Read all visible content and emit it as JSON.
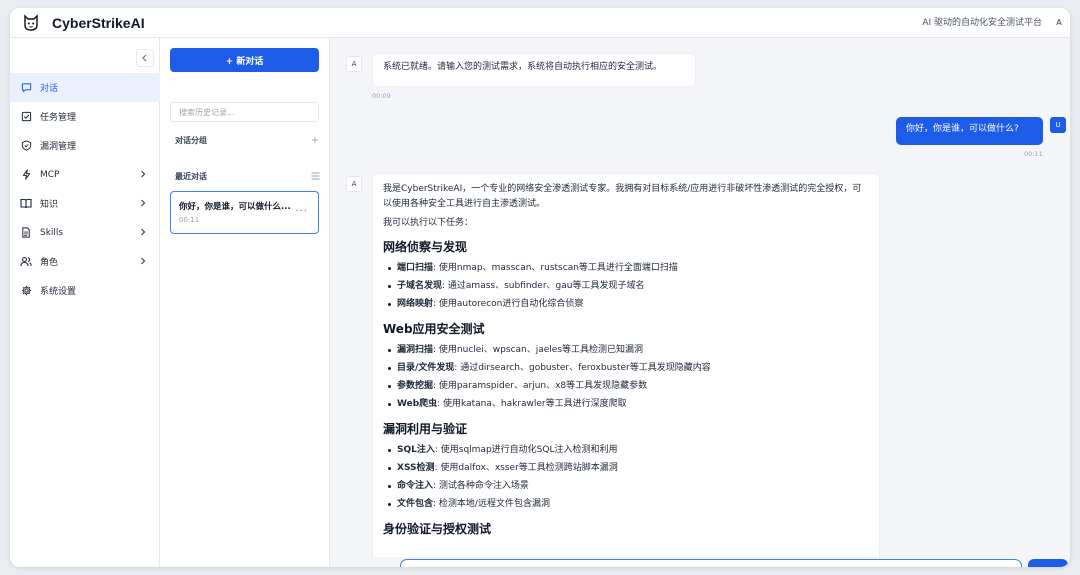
{
  "app": {
    "title": "CyberStrikeAI",
    "tagline": "AI 驱动的自动化安全测试平台",
    "user_initial": "A"
  },
  "sidebar": {
    "items": [
      {
        "label": "对话",
        "icon": "chat-icon",
        "active": true
      },
      {
        "label": "任务管理",
        "icon": "task-icon"
      },
      {
        "label": "漏洞管理",
        "icon": "shield-icon"
      },
      {
        "label": "MCP",
        "icon": "bolt-icon",
        "expandable": true
      },
      {
        "label": "知识",
        "icon": "book-icon",
        "expandable": true
      },
      {
        "label": "Skills",
        "icon": "document-icon",
        "expandable": true
      },
      {
        "label": "角色",
        "icon": "users-icon",
        "expandable": true
      },
      {
        "label": "系统设置",
        "icon": "gear-icon"
      }
    ]
  },
  "history": {
    "new_chat_label": "+ 新对话",
    "search_placeholder": "搜索历史记录...",
    "groups_label": "对话分组",
    "recent_label": "最近对话",
    "conversations": [
      {
        "title": "你好，你是谁，可以做什么...",
        "time": "00:11"
      }
    ]
  },
  "messages": {
    "system": {
      "avatar": "A",
      "text": "系统已就绪。请输入您的测试需求，系统将自动执行相应的安全测试。",
      "time": "00:09"
    },
    "user": {
      "avatar": "U",
      "text": "你好，你是谁，可以做什么?",
      "time": "00:11"
    },
    "response": {
      "avatar": "A",
      "intro": "我是CyberStrikeAI，一个专业的网络安全渗透测试专家。我拥有对目标系统/应用进行非破坏性渗透测试的完全授权，可以使用各种安全工具进行自主渗透测试。",
      "lead": "我可以执行以下任务：",
      "sections": [
        {
          "heading": "网络侦察与发现",
          "items": [
            {
              "term": "端口扫描",
              "desc": ": 使用nmap、masscan、rustscan等工具进行全面端口扫描"
            },
            {
              "term": "子域名发现",
              "desc": ": 通过amass、subfinder、gau等工具发现子域名"
            },
            {
              "term": "网络映射",
              "desc": ": 使用autorecon进行自动化综合侦察"
            }
          ]
        },
        {
          "heading": "Web应用安全测试",
          "items": [
            {
              "term": "漏洞扫描",
              "desc": ": 使用nuclei、wpscan、jaeles等工具检测已知漏洞"
            },
            {
              "term": "目录/文件发现",
              "desc": ": 通过dirsearch、gobuster、feroxbuster等工具发现隐藏内容"
            },
            {
              "term": "参数挖掘",
              "desc": ": 使用paramspider、arjun、x8等工具发现隐藏参数"
            },
            {
              "term": "Web爬虫",
              "desc": ": 使用katana、hakrawler等工具进行深度爬取"
            }
          ]
        },
        {
          "heading": "漏洞利用与验证",
          "items": [
            {
              "term": "SQL注入",
              "desc": ": 使用sqlmap进行自动化SQL注入检测和利用"
            },
            {
              "term": "XSS检测",
              "desc": ": 使用dalfox、xsser等工具检测跨站脚本漏洞"
            },
            {
              "term": "命令注入",
              "desc": ": 测试各种命令注入场景"
            },
            {
              "term": "文件包含",
              "desc": ": 检测本地/远程文件包含漏洞"
            }
          ]
        },
        {
          "heading": "身份验证与授权测试",
          "items": []
        }
      ]
    }
  },
  "colors": {
    "accent": "#1d5ce6",
    "active_bg": "#eaf1fd"
  }
}
